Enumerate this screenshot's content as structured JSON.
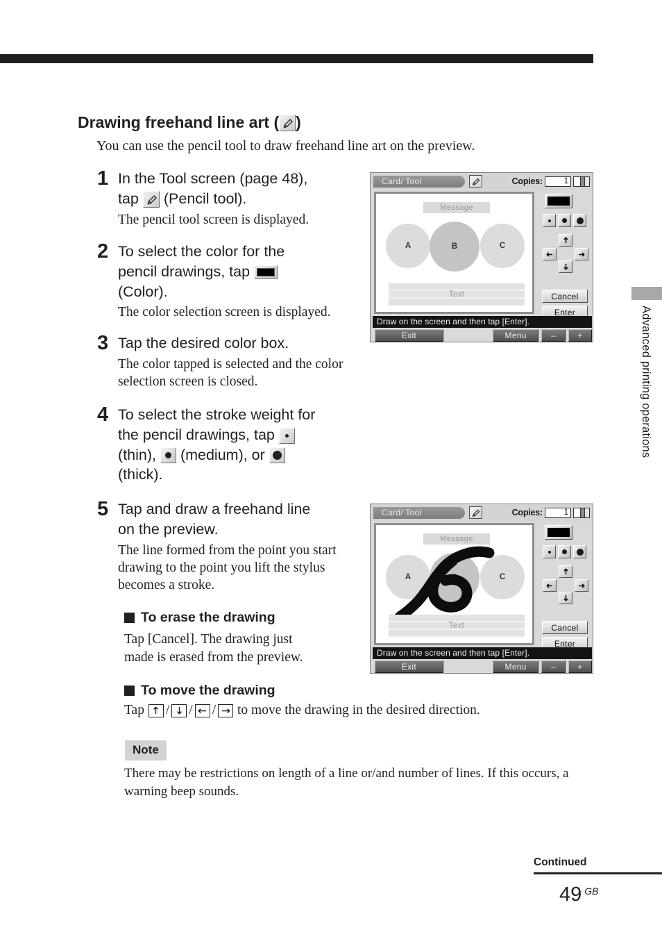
{
  "page": {
    "heading": "Drawing freehand line art (",
    "heading_close": ")",
    "intro": "You can use the pencil tool to draw freehand line art on the preview.",
    "side_tab": "Advanced printing operations",
    "continued": "Continued",
    "page_number": "49",
    "page_suffix": "GB"
  },
  "steps": [
    {
      "num": "1",
      "title_a": "In the Tool screen (page 48),",
      "title_b": "tap",
      "title_c": "(Pencil tool).",
      "desc": "The pencil tool screen is displayed."
    },
    {
      "num": "2",
      "title_a": "To select the color for the",
      "title_b": "pencil drawings, tap",
      "title_c": "(Color).",
      "desc": "The color selection screen is displayed."
    },
    {
      "num": "3",
      "title_a": "Tap the desired color box.",
      "desc": "The color tapped is selected and the color selection screen is closed."
    },
    {
      "num": "4",
      "title_a": "To select the stroke weight for",
      "title_b": "the pencil drawings, tap",
      "title_c": "(thin),",
      "title_d": "(medium), or",
      "title_e": "(thick)."
    },
    {
      "num": "5",
      "title_a": "Tap and draw a freehand line",
      "title_b": "on the preview.",
      "desc": "The line formed from the point you start drawing to the point you lift the stylus becomes a stroke."
    }
  ],
  "sections": {
    "erase_heading": "To erase the drawing",
    "erase_body": "Tap [Cancel].  The drawing just made is erased from the preview.",
    "move_heading": "To move the drawing",
    "move_prefix": "Tap",
    "move_suffix": "to move the drawing in the desired direction."
  },
  "note": {
    "label": "Note",
    "body": "There may be restrictions on length of a line or/and number of lines.  If this occurs, a warning beep sounds."
  },
  "device": {
    "tab_label": "Card/ Tool",
    "copies_label": "Copies:",
    "copies_value": "1",
    "preview": {
      "message_placeholder": "Message",
      "circle_a": "A",
      "circle_b": "B",
      "circle_c": "C",
      "text_placeholder": "Text"
    },
    "controls": {
      "cancel": "Cancel",
      "enter": "Enter",
      "color_swatch": "#000000"
    },
    "status": "Draw on the screen and then tap [Enter].",
    "buttons": {
      "exit": "Exit",
      "menu": "Menu",
      "minus": "–",
      "plus": "+"
    }
  }
}
